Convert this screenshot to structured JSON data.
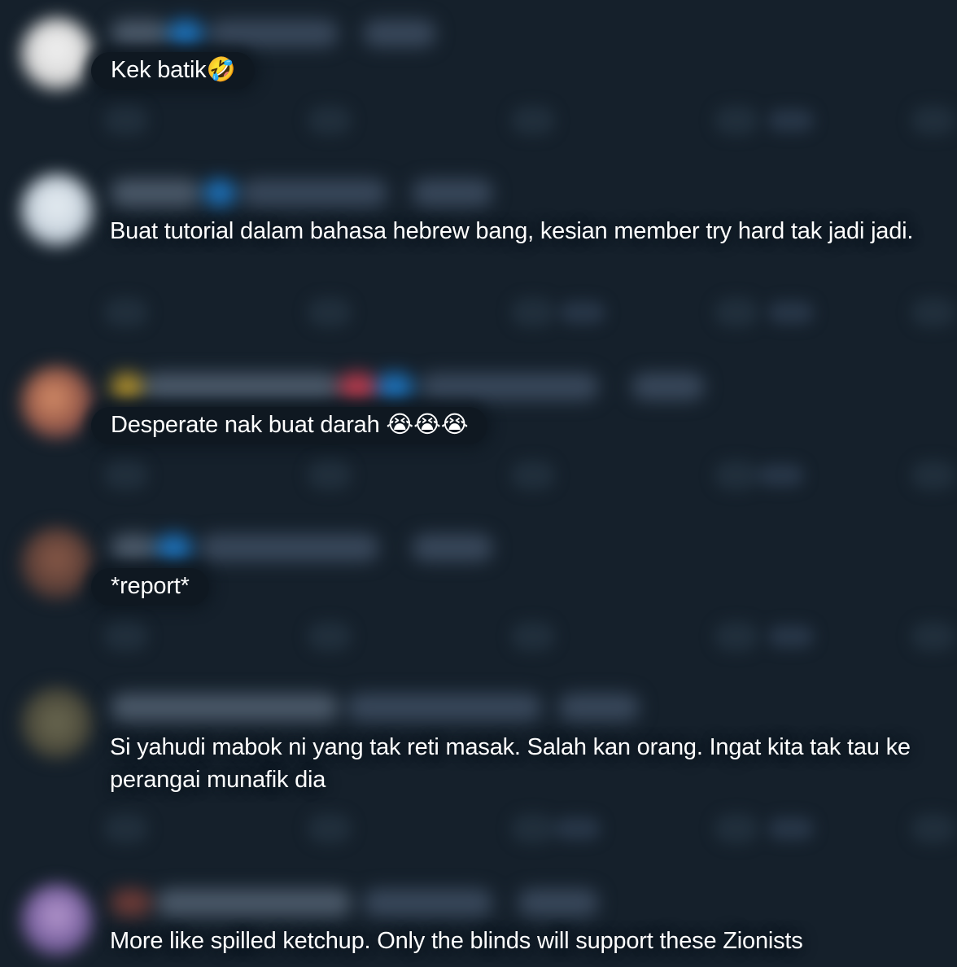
{
  "replies": [
    {
      "text": "Kek batik🤣"
    },
    {
      "text": "Buat tutorial dalam bahasa hebrew bang, kesian member try hard tak jadi jadi."
    },
    {
      "text": "Desperate nak buat darah 😭😭😭"
    },
    {
      "text": "*report*"
    },
    {
      "text": "Si yahudi mabok ni yang tak reti masak. Salah kan orang. Ingat kita tak tau ke perangai munafik dia"
    },
    {
      "text": "More like spilled ketchup. Only the blinds will support these Zionists"
    }
  ],
  "colors": {
    "background": "#15202b",
    "text": "#ffffff",
    "verified_badge": "#1d9bf0"
  }
}
